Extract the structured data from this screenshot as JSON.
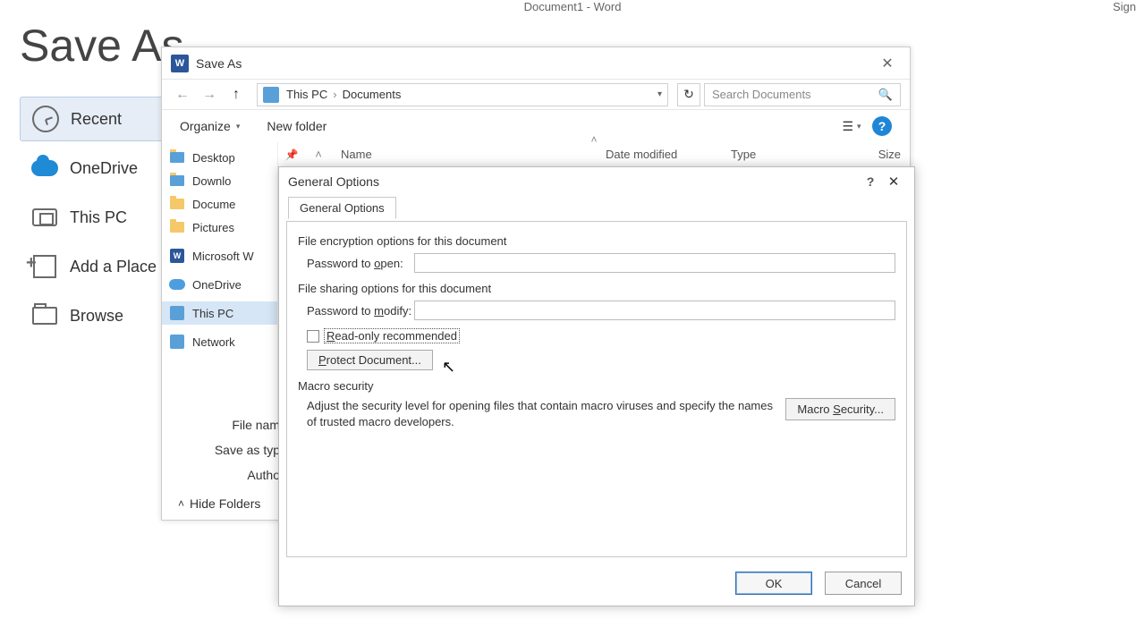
{
  "app": {
    "title": "Document1 - Word",
    "sign": "Sign"
  },
  "backstage": {
    "title": "Save As",
    "nav": {
      "recent": "Recent",
      "onedrive": "OneDrive",
      "thispc": "This PC",
      "addplace": "Add a Place",
      "browse": "Browse"
    }
  },
  "saveas": {
    "title": "Save As",
    "breadcrumb": {
      "root": "This PC",
      "folder": "Documents"
    },
    "search_placeholder": "Search Documents",
    "organize": "Organize",
    "newfolder": "New folder",
    "columns": {
      "name": "Name",
      "modified": "Date modified",
      "type": "Type",
      "size": "Size"
    },
    "tree": {
      "desktop": "Desktop",
      "downloads": "Downlo",
      "documents": "Docume",
      "pictures": "Pictures",
      "msword": "Microsoft W",
      "onedrive": "OneDrive",
      "thispc": "This PC",
      "network": "Network"
    },
    "fields": {
      "filename_label": "File nam",
      "savetype_label": "Save as typ",
      "authors_label": "Autho"
    },
    "hide_folders": "Hide Folders"
  },
  "genopt": {
    "title": "General Options",
    "tab": "General Options",
    "enc_label": "File encryption options for this document",
    "pw_open": "Password to open:",
    "share_label": "File sharing options for this document",
    "pw_modify": "Password to modify:",
    "readonly": "Read-only recommended",
    "protect": "Protect Document...",
    "macro_label": "Macro security",
    "macro_text": "Adjust the security level for opening files that contain macro viruses and specify the names of trusted macro developers.",
    "macro_btn": "Macro Security...",
    "ok": "OK",
    "cancel": "Cancel"
  }
}
